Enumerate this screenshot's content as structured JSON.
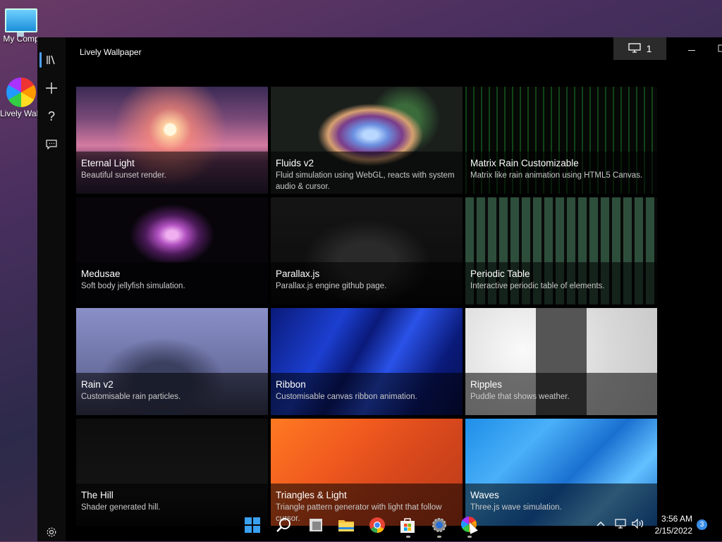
{
  "desktop": {
    "icons": [
      {
        "label": "My Comp"
      },
      {
        "label": "Lively Wallpap"
      }
    ]
  },
  "app": {
    "title": "Lively Wallpaper",
    "monitor_count": "1",
    "nav": [
      {
        "icon": "library-icon"
      },
      {
        "icon": "plus-icon"
      },
      {
        "icon": "help-icon"
      },
      {
        "icon": "chat-icon"
      },
      {
        "icon": "gear-icon"
      }
    ]
  },
  "wallpapers": [
    {
      "title": "Eternal Light",
      "desc": "Beautiful sunset render.",
      "selected": true
    },
    {
      "title": "Fluids v2",
      "desc": "Fluid simulation using WebGL, reacts with system audio & cursor."
    },
    {
      "title": "Matrix Rain Customizable",
      "desc": "Matrix like rain animation using HTML5 Canvas."
    },
    {
      "title": "Medusae",
      "desc": "Soft body jellyfish simulation."
    },
    {
      "title": "Parallax.js",
      "desc": "Parallax.js engine github page."
    },
    {
      "title": "Periodic Table",
      "desc": "Interactive periodic table of elements."
    },
    {
      "title": "Rain v2",
      "desc": "Customisable rain particles."
    },
    {
      "title": "Ribbon",
      "desc": "Customisable canvas ribbon animation."
    },
    {
      "title": "Ripples",
      "desc": "Puddle that shows weather."
    },
    {
      "title": "The Hill",
      "desc": "Shader generated hill."
    },
    {
      "title": "Triangles & Light",
      "desc": "Triangle pattern generator with light that follow cursor."
    },
    {
      "title": "Waves",
      "desc": "Three.js wave simulation."
    }
  ],
  "taskbar": {
    "time": "3:56 AM",
    "date": "2/15/2022",
    "notification_count": "3"
  }
}
